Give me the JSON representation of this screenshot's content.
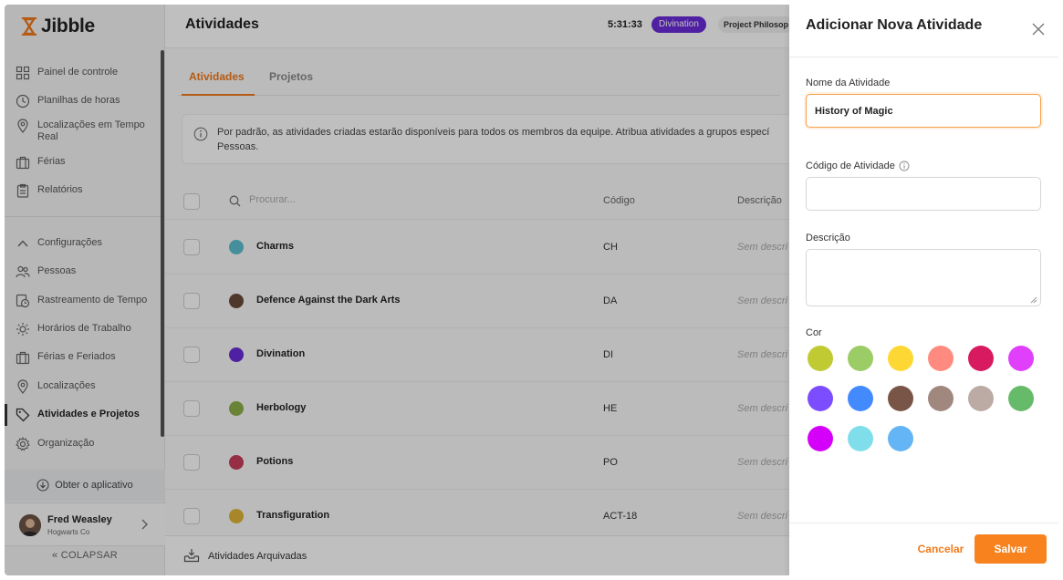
{
  "brand": {
    "name": "Jibble"
  },
  "sidebar": {
    "items": [
      {
        "label": "Painel de controle",
        "icon": "dashboard-icon"
      },
      {
        "label": "Planilhas de horas",
        "icon": "clock-icon"
      },
      {
        "label": "Localizações em Tempo Real",
        "icon": "location-pin-icon"
      },
      {
        "label": "Férias",
        "icon": "suitcase-icon"
      },
      {
        "label": "Relatórios",
        "icon": "clipboard-icon"
      },
      {
        "label": "Configurações",
        "icon": "chevron-up-icon"
      },
      {
        "label": "Pessoas",
        "icon": "people-icon"
      },
      {
        "label": "Rastreamento de Tempo",
        "icon": "time-tracking-icon"
      },
      {
        "label": "Horários de Trabalho",
        "icon": "sun-icon"
      },
      {
        "label": "Férias e Feriados",
        "icon": "suitcase-icon"
      },
      {
        "label": "Localizações",
        "icon": "location-pin-icon"
      },
      {
        "label": "Atividades e Projetos",
        "icon": "tag-icon"
      },
      {
        "label": "Organização",
        "icon": "gear-icon"
      }
    ],
    "get_app": "Obter o aplicativo",
    "user": {
      "name": "Fred Weasley",
      "org": "Hogwarts Co"
    },
    "collapse": "COLAPSAR"
  },
  "header": {
    "title": "Atividades",
    "timer": "5:31:33",
    "current_activity": "Divination",
    "current_project": "Project Philosop"
  },
  "tabs": [
    {
      "label": "Atividades"
    },
    {
      "label": "Projetos"
    }
  ],
  "info": {
    "line1": "Por padrão, as atividades criadas estarão disponíveis para todos os membros da equipe. Atribua atividades a grupos especí",
    "line2": "Pessoas."
  },
  "list": {
    "search_placeholder": "Procurar...",
    "col_code": "Código",
    "col_desc": "Descrição",
    "rows": [
      {
        "name": "Charms",
        "code": "CH",
        "desc": "Sem descri",
        "color": "#5bbfcf"
      },
      {
        "name": "Defence Against the Dark Arts",
        "code": "DA",
        "desc": "Sem descri",
        "color": "#6b4a3a"
      },
      {
        "name": "Divination",
        "code": "DI",
        "desc": "Sem descri",
        "color": "#6a2bd9"
      },
      {
        "name": "Herbology",
        "code": "HE",
        "desc": "Sem descri",
        "color": "#8cb04a"
      },
      {
        "name": "Potions",
        "code": "PO",
        "desc": "Sem descri",
        "color": "#c93f5c"
      },
      {
        "name": "Transfiguration",
        "code": "ACT-18",
        "desc": "Sem descri",
        "color": "#e0b43a"
      }
    ],
    "archived": "Atividades Arquivadas"
  },
  "drawer": {
    "title": "Adicionar Nova Atividade",
    "name_label": "Nome da Atividade",
    "name_value": "History of Magic",
    "code_label": "Código de Atividade",
    "code_value": "",
    "desc_label": "Descrição",
    "desc_value": "",
    "color_label": "Cor",
    "colors": [
      "#c0ca33",
      "#9ccc65",
      "#fdd835",
      "#ff8a80",
      "#d81b60",
      "#e040fb",
      "#7c4dff",
      "#448aff",
      "#795548",
      "#a1887f",
      "#bcaaa4",
      "#66bb6a",
      "#d500f9",
      "#80deea",
      "#64b5f6"
    ],
    "cancel": "Cancelar",
    "save": "Salvar"
  }
}
